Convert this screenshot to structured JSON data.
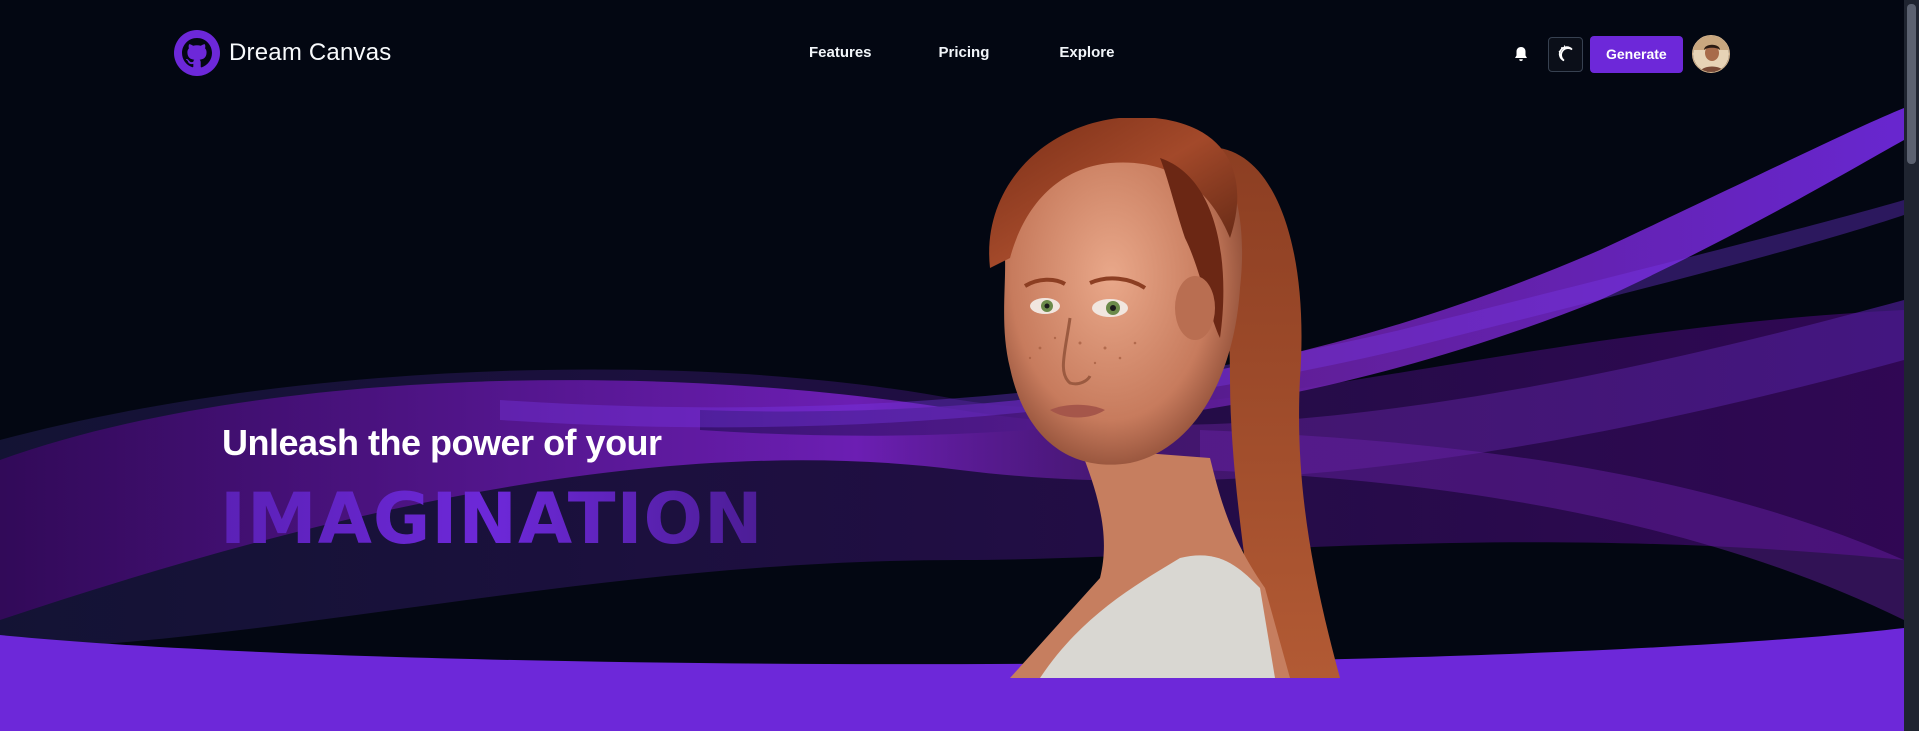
{
  "brand": {
    "name": "Dream Canvas",
    "logo_icon": "github-octocat-icon",
    "logo_color": "#6d28d9"
  },
  "nav": {
    "links": [
      {
        "label": "Features"
      },
      {
        "label": "Pricing"
      },
      {
        "label": "Explore"
      }
    ]
  },
  "actions": {
    "notifications_icon": "bell-icon",
    "theme_toggle_icon": "moon-stars-icon",
    "generate_label": "Generate",
    "avatar_icon": "user-avatar"
  },
  "hero": {
    "subtitle": "Unleash the power of your",
    "headline": "IMAGINATION",
    "image_alt_icon": "portrait-image"
  },
  "colors": {
    "background": "#030712",
    "accent": "#6d28d9",
    "accent_dark": "#5b21b6",
    "bottom_band": "#6d28d9"
  }
}
